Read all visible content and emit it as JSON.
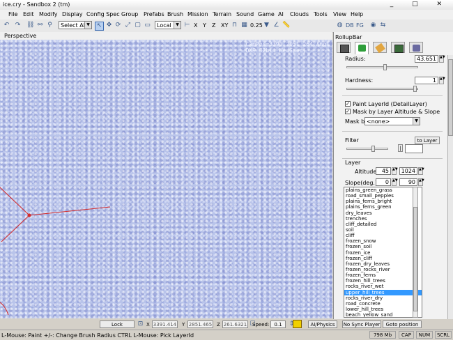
{
  "window": {
    "title": "ice.cry - Sandbox 2 (tm)",
    "controls": [
      "_",
      "□",
      "✕"
    ]
  },
  "menu": [
    "File",
    "Edit",
    "Modify",
    "Display",
    "Config Spec",
    "Group",
    "Prefabs",
    "Brush",
    "Mission",
    "Terrain",
    "Sound",
    "Game",
    "AI",
    "Clouds",
    "Tools",
    "View",
    "Help"
  ],
  "toolbar": {
    "selection_filter": "Select All",
    "coord_system": "Local",
    "axes": [
      "X",
      "Y",
      "Z",
      "XY"
    ],
    "grid_size": "0.25",
    "right_labels": [
      "DB",
      "FG"
    ]
  },
  "viewport": {
    "title": "Perspective",
    "cam_line1": "CamPos=3390 2051 264 Angl",
    "cam_line2": "DX9 32bit MedSpec("
  },
  "statusrow": {
    "lock_selection": "Lock Selection",
    "x_label": "X",
    "x_value": "3391.414",
    "y_label": "Y",
    "y_value": "2851.465",
    "z_label": "Z",
    "z_value": "261.6321",
    "speed_label": "Speed:",
    "speed_value": "0.1",
    "ai_physics": "AI/Physics",
    "no_sync_player": "No Sync Player",
    "goto_position": "Goto position"
  },
  "statusbar": {
    "hint": "L-Mouse: Paint  +/-: Change Brush Radius  CTRL L-Mouse: Pick LayerId",
    "memory": "798 Mb",
    "cap": "CAP",
    "num": "NUM",
    "scrl": "SCRL"
  },
  "rollup": {
    "title": "RollupBar",
    "radius_label": "Radius:",
    "radius_value": "43.651",
    "hardness_label": "Hardness:",
    "hardness_value": "1",
    "paint_layerid_label": "Paint LayerId (DetailLayer)",
    "paint_layerid_checked": true,
    "mask_by_altitude_label": "Mask by Layer Altitude & Slope",
    "mask_by_altitude_checked": true,
    "mask_by_label": "Mask by",
    "mask_by_value": "<none>",
    "filter_label": "Filter",
    "to_layer_button": "to Layer",
    "filter_button": "|",
    "layer_label": "Layer",
    "altitude_label": "Altitude",
    "altitude_min": "45",
    "altitude_max": "1024",
    "slope_label": "Slope(deg.)",
    "slope_min": "0",
    "slope_max": "90",
    "layers": [
      "plains_green_grass",
      "road_small_pepples",
      "plains_ferns_bright",
      "plains_ferns_green",
      "dry_leaves",
      "trenches",
      "cliff_detailed",
      "soil",
      "cliff",
      "frozen_snow",
      "frozen_soil",
      "frozen_ice",
      "frozen_cliff",
      "frozen_dry_leaves",
      "frozen_rocks_river",
      "frozen_ferns",
      "frozen_hill_trees",
      "rocks_river_wet",
      "upper_hill_trees",
      "rocks_river_dry",
      "road_concrete",
      "lower_hill_trees",
      "beach_yellow_sand"
    ],
    "selected_layer": "upper_hill_trees"
  },
  "colors": {
    "selection": "#3399ff",
    "terrain": "#b9c4ea",
    "gizmo": "#d42a2a"
  }
}
